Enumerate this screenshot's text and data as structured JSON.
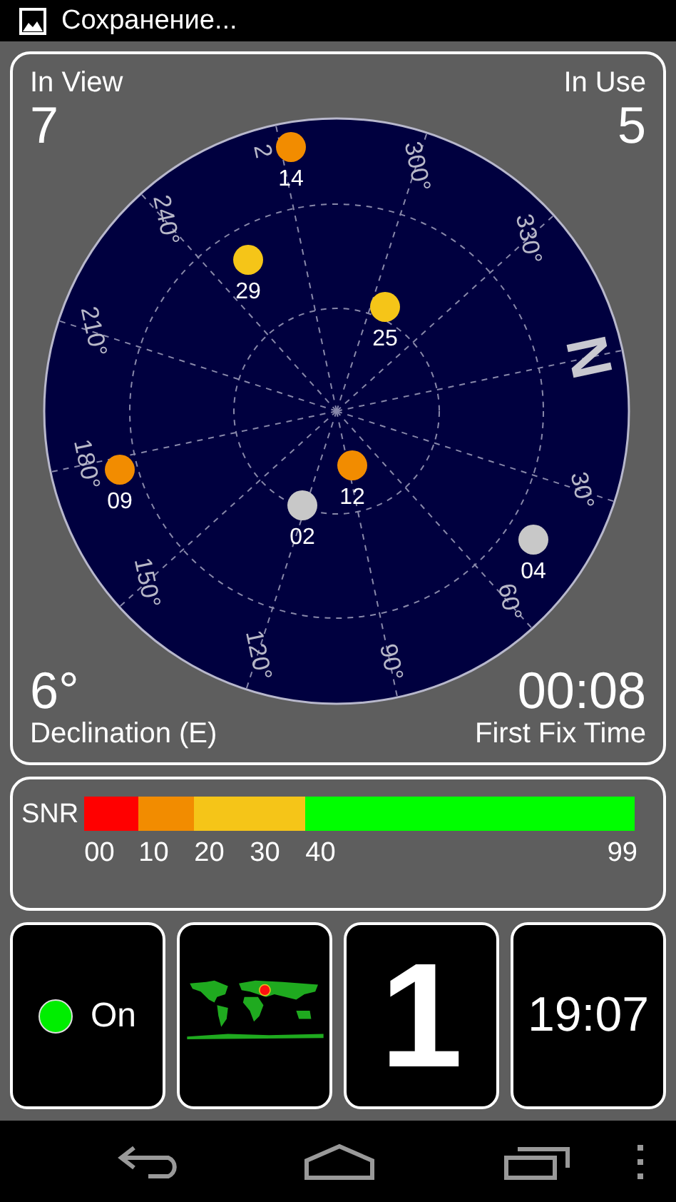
{
  "status_bar": {
    "title": "Сохранение..."
  },
  "sky": {
    "in_view_label": "In View",
    "in_view": "7",
    "in_use_label": "In Use",
    "in_use": "5",
    "azimuth_labels": [
      "N",
      "30°",
      "60°",
      "90°",
      "120°",
      "150°",
      "180°",
      "210°",
      "240°",
      "2",
      "300°",
      "330°"
    ],
    "satellites": [
      {
        "prn": "14",
        "color": "#f28c00"
      },
      {
        "prn": "29",
        "color": "#f5c518"
      },
      {
        "prn": "25",
        "color": "#f5c518"
      },
      {
        "prn": "09",
        "color": "#f28c00"
      },
      {
        "prn": "12",
        "color": "#f28c00"
      },
      {
        "prn": "02",
        "color": "#c8c8c8"
      },
      {
        "prn": "04",
        "color": "#c8c8c8"
      }
    ],
    "declination": {
      "value": "6°",
      "label": "Declination (E)"
    },
    "first_fix": {
      "value": "00:08",
      "label": "First Fix Time"
    }
  },
  "snr": {
    "label": "SNR",
    "segments": [
      {
        "color": "#ff0000"
      },
      {
        "color": "#f28c00"
      },
      {
        "color": "#f5c518"
      },
      {
        "color": "#00ff00"
      }
    ],
    "ticks": [
      "00",
      "10",
      "20",
      "30",
      "40",
      "99"
    ]
  },
  "tiles": [
    {
      "kind": "status",
      "on": true,
      "label": "On"
    },
    {
      "kind": "map"
    },
    {
      "kind": "count",
      "value": "1"
    },
    {
      "kind": "clock",
      "value": "19:07"
    }
  ]
}
